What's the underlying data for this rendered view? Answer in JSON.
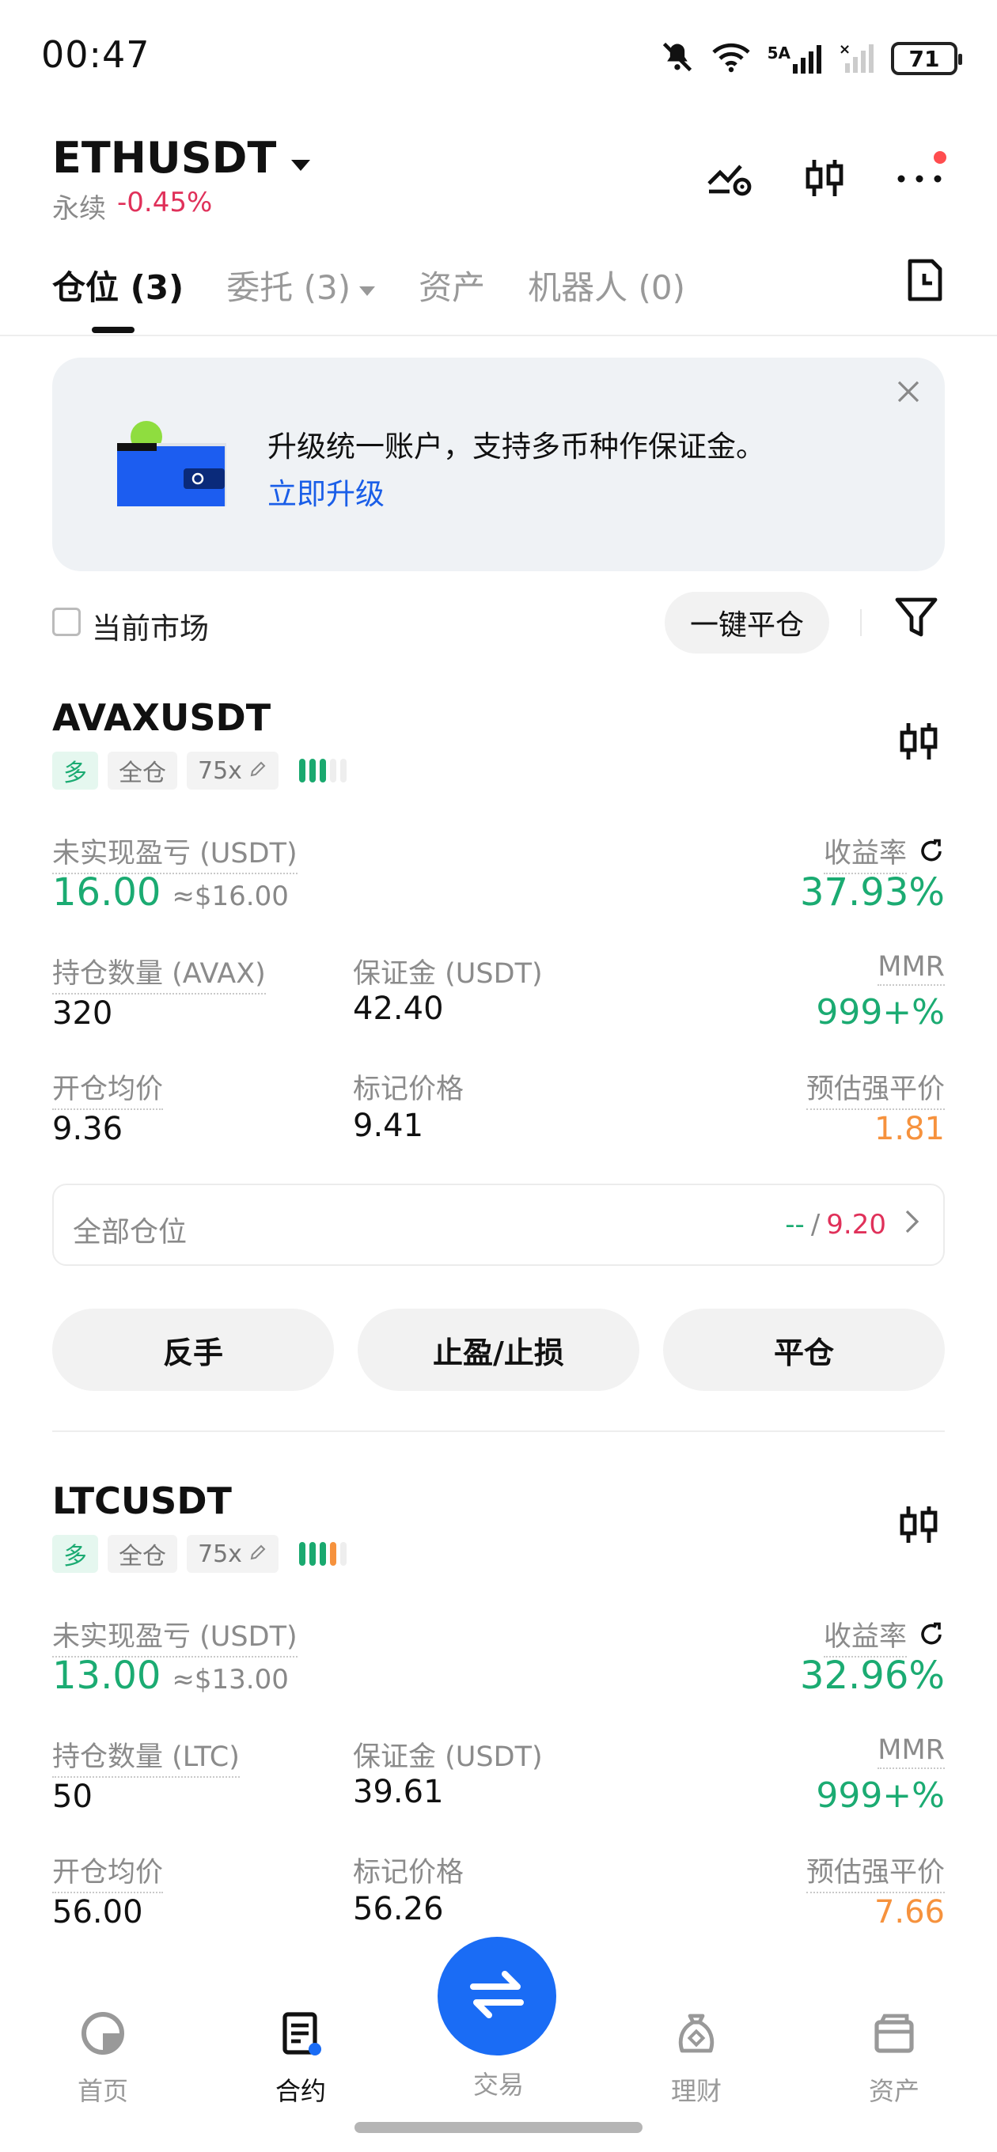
{
  "status_bar": {
    "time": "00:47",
    "network_label": "5A",
    "battery": "71"
  },
  "header": {
    "symbol": "ETHUSDT",
    "type": "永续",
    "change": "-0.45%"
  },
  "tabs": [
    {
      "label": "仓位 (3)"
    },
    {
      "label": "委托 (3)"
    },
    {
      "label": "资产"
    },
    {
      "label": "机器人 (0)"
    }
  ],
  "banner": {
    "text": "升级统一账户，支持多币种作保证金。",
    "link": "立即升级"
  },
  "filter": {
    "current_market": "当前市场",
    "close_all": "一键平仓"
  },
  "positions": [
    {
      "symbol": "AVAXUSDT",
      "side": "多",
      "margin_mode": "全仓",
      "leverage": "75x",
      "pnl_label": "未实现盈亏 (USDT)",
      "pnl": "16.00",
      "pnl_approx": "≈$16.00",
      "roe_label": "收益率",
      "roe": "37.93%",
      "size_label": "持仓数量 (AVAX)",
      "size": "320",
      "margin_label": "保证金 (USDT)",
      "margin": "42.40",
      "mmr_label": "MMR",
      "mmr": "999+%",
      "entry_label": "开仓均价",
      "entry": "9.36",
      "mark_label": "标记价格",
      "mark": "9.41",
      "liq_label": "预估强平价",
      "liq": "1.81",
      "all_positions_label": "全部仓位",
      "all_positions_left": "--",
      "all_positions_sep": "/",
      "all_positions_right": "9.20",
      "btn_reverse": "反手",
      "btn_tpsl": "止盈/止损",
      "btn_close": "平仓"
    },
    {
      "symbol": "LTCUSDT",
      "side": "多",
      "margin_mode": "全仓",
      "leverage": "75x",
      "pnl_label": "未实现盈亏 (USDT)",
      "pnl": "13.00",
      "pnl_approx": "≈$13.00",
      "roe_label": "收益率",
      "roe": "32.96%",
      "size_label": "持仓数量 (LTC)",
      "size": "50",
      "margin_label": "保证金 (USDT)",
      "margin": "39.61",
      "mmr_label": "MMR",
      "mmr": "999+%",
      "entry_label": "开仓均价",
      "entry": "56.00",
      "mark_label": "标记价格",
      "mark": "56.26",
      "liq_label": "预估强平价",
      "liq": "7.66"
    }
  ],
  "bottom_nav": [
    {
      "label": "首页",
      "icon": "home-icon"
    },
    {
      "label": "合约",
      "icon": "contract-icon"
    },
    {
      "label": "交易",
      "icon": "swap-icon"
    },
    {
      "label": "理财",
      "icon": "finance-icon"
    },
    {
      "label": "资产",
      "icon": "wallet-icon"
    }
  ],
  "colors": {
    "green": "#1bab72",
    "red": "#e0315a",
    "orange": "#f6923d",
    "blue": "#1a6cf5"
  }
}
